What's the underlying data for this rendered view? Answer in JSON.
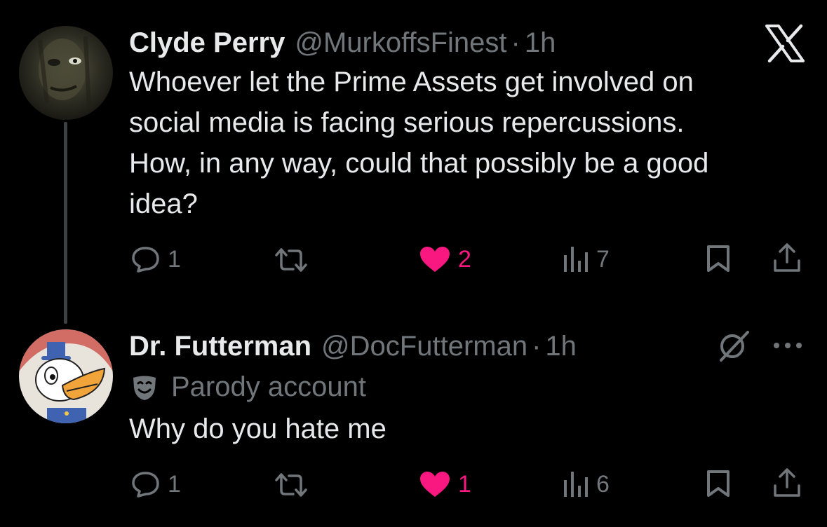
{
  "brand": {
    "icon": "x-logo-icon"
  },
  "tweets": [
    {
      "author": "Clyde Perry",
      "handle": "@MurkoffsFinest",
      "separator": "·",
      "time": "1h",
      "lines": [
        "Whoever let the Prime Assets get involved on",
        "social media is facing serious repercussions.",
        "How, in any way, could that possibly be a good",
        "idea?"
      ],
      "replies": "1",
      "likes": "2",
      "views": "7",
      "liked": true
    },
    {
      "author": "Dr. Futterman",
      "handle": "@DocFutterman",
      "separator": "·",
      "time": "1h",
      "label": "Parody account",
      "text": "Why do you hate me",
      "replies": "1",
      "likes": "1",
      "views": "6",
      "liked": true
    }
  ],
  "colors": {
    "background": "#000000",
    "text": "#e7e9ea",
    "muted": "#71767b",
    "like": "#f91880"
  }
}
